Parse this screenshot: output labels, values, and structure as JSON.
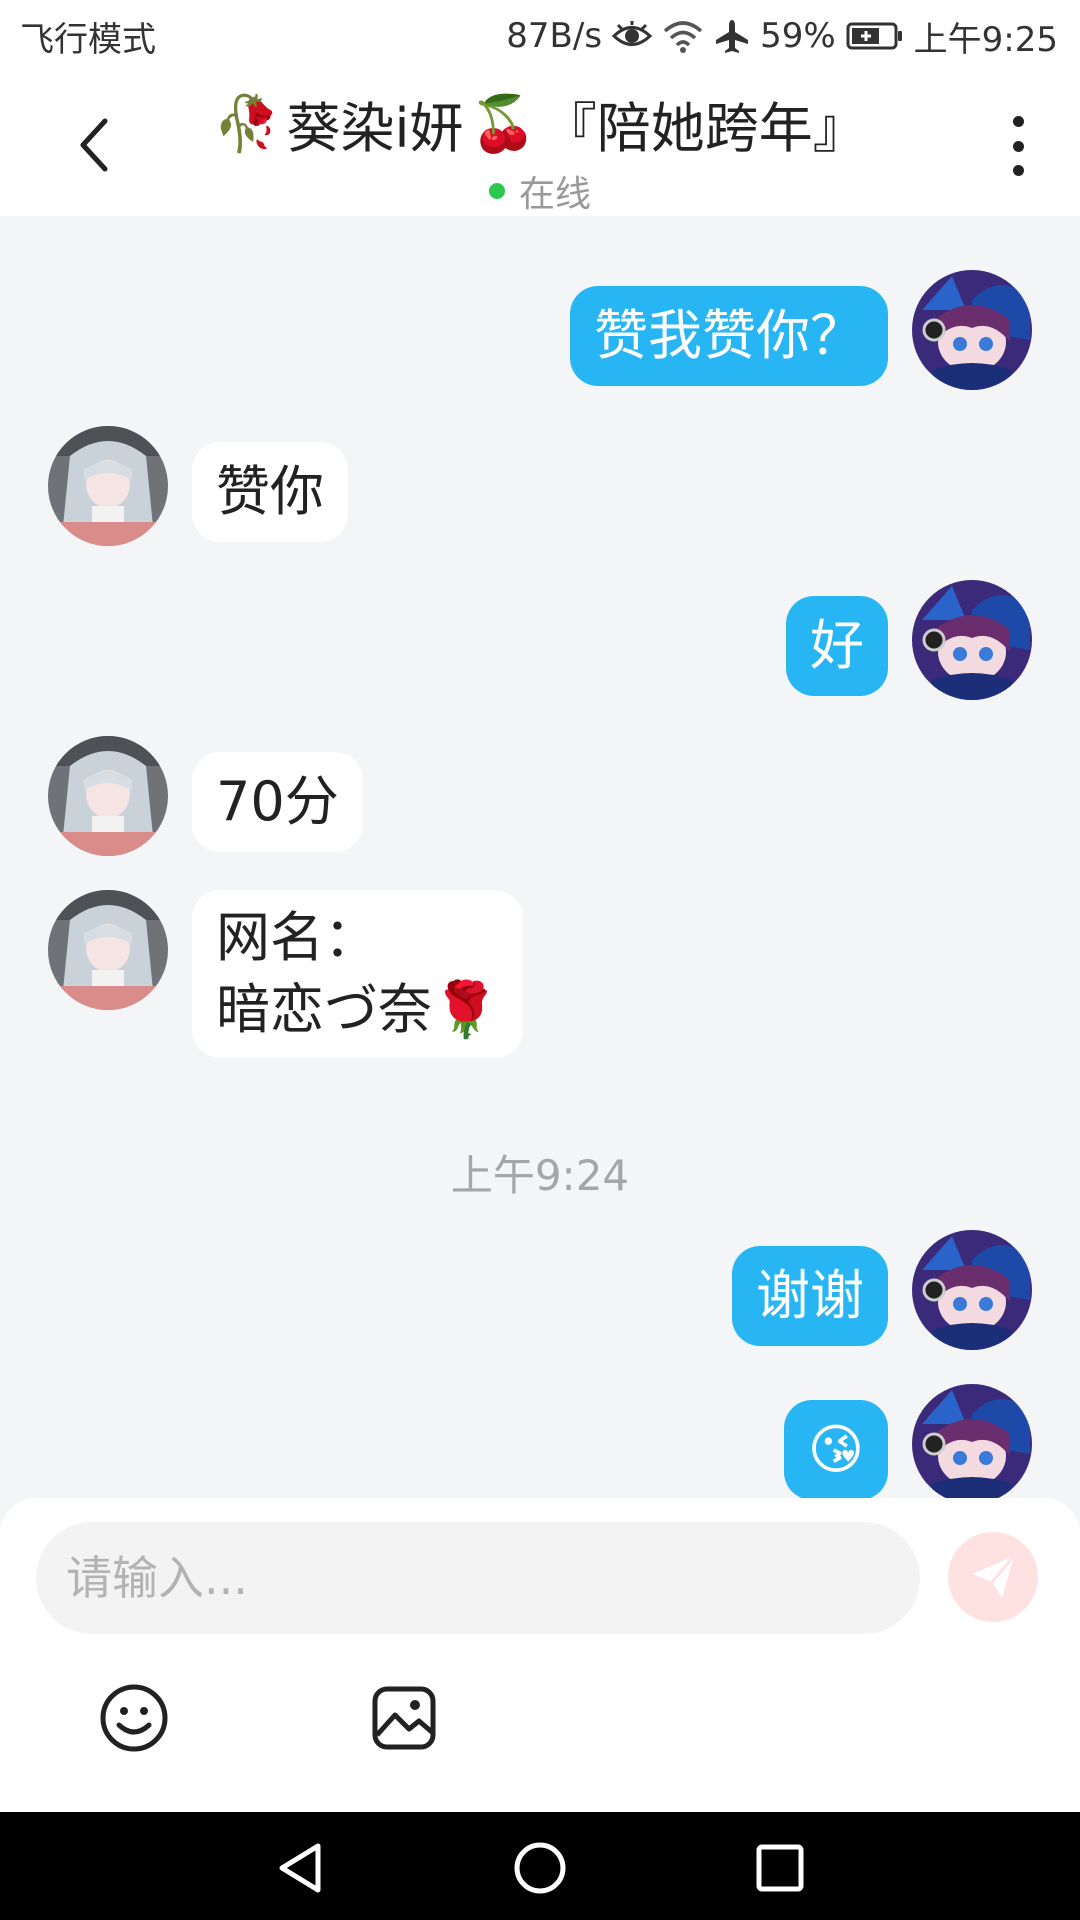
{
  "status_bar": {
    "mode": "飞行模式",
    "net_speed": "87B/s",
    "battery": "59%",
    "time": "上午9:25"
  },
  "header": {
    "title": "葵染i妍",
    "title_suffix": "『陪她跨年』",
    "status": "在线",
    "title_emojis": [
      "🥀",
      "🍒"
    ]
  },
  "messages": [
    {
      "side": "me",
      "text": "赞我赞你？"
    },
    {
      "side": "them",
      "text": "赞你"
    },
    {
      "side": "me",
      "text": "好"
    },
    {
      "side": "them",
      "text": "70分"
    },
    {
      "side": "them",
      "line1": "网名：",
      "line2": "暗恋づ奈",
      "emoji": "🌹"
    },
    {
      "side": "me",
      "text": "谢谢"
    },
    {
      "side": "me",
      "emoji": "😘"
    }
  ],
  "time_divider": "上午9:24",
  "input": {
    "placeholder": "请输入..."
  },
  "icons": [
    "back-icon",
    "more-icon",
    "send-icon",
    "emoji-icon",
    "image-icon",
    "eye-icon",
    "wifi-icon",
    "airplane-icon",
    "battery-icon"
  ],
  "colors": {
    "my_bubble": "#27b6f3",
    "their_bubble": "#ffffff",
    "background": "#f3f5f7",
    "online_dot": "#2bc84f",
    "send_button": "#fde2e1"
  }
}
